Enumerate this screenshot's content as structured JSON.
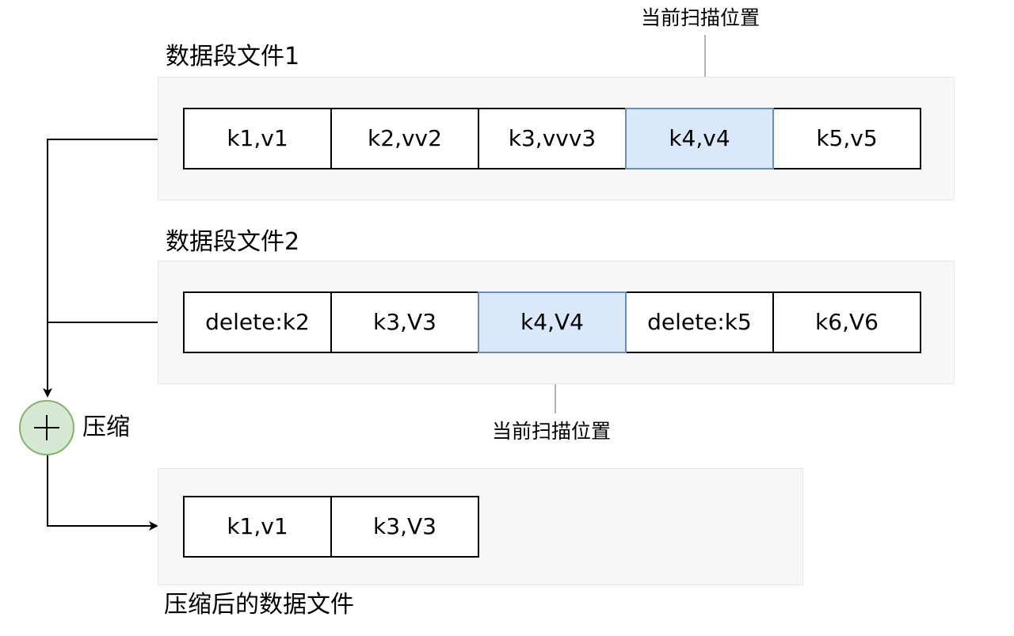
{
  "file1": {
    "title": "数据段文件1",
    "cells": [
      {
        "text": "k1,v1",
        "highlight": false
      },
      {
        "text": "k2,vv2",
        "highlight": false
      },
      {
        "text": "k3,vvv3",
        "highlight": false
      },
      {
        "text": "k4,v4",
        "highlight": true
      },
      {
        "text": "k5,v5",
        "highlight": false
      }
    ],
    "scan_label": "当前扫描位置"
  },
  "file2": {
    "title": "数据段文件2",
    "cells": [
      {
        "text": "delete:k2",
        "highlight": false
      },
      {
        "text": "k3,V3",
        "highlight": false
      },
      {
        "text": "k4,V4",
        "highlight": true
      },
      {
        "text": "delete:k5",
        "highlight": false
      },
      {
        "text": "k6,V6",
        "highlight": false
      }
    ],
    "scan_label": "当前扫描位置"
  },
  "merge": {
    "label": "压缩",
    "icon": "plus-circle-icon"
  },
  "result": {
    "title": "压缩后的数据文件",
    "cells": [
      {
        "text": "k1,v1",
        "highlight": false
      },
      {
        "text": "k3,V3",
        "highlight": false
      }
    ]
  },
  "colors": {
    "highlight_fill": "#dae8fc",
    "highlight_stroke": "#6c8ebf",
    "merge_fill": "#d5e8d4",
    "merge_stroke": "#82b366",
    "scan_arrow": "#b3b3b3",
    "panel_fill": "#f7f7f7"
  }
}
